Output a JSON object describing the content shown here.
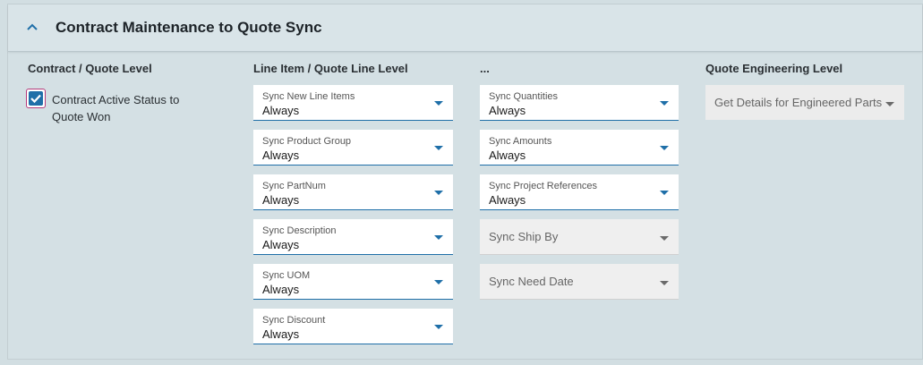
{
  "section": {
    "title": "Contract Maintenance to Quote Sync"
  },
  "columns": {
    "contract": "Contract / Quote Level",
    "line_item": "Line Item / Quote Line Level",
    "more": "...",
    "engineering": "Quote Engineering Level"
  },
  "contract_active": {
    "label": "Contract Active Status to Quote Won",
    "checked": true
  },
  "line_item_dropdowns": [
    {
      "label": "Sync New Line Items",
      "value": "Always"
    },
    {
      "label": "Sync Product Group",
      "value": "Always"
    },
    {
      "label": "Sync PartNum",
      "value": "Always"
    },
    {
      "label": "Sync Description",
      "value": "Always"
    },
    {
      "label": "Sync UOM",
      "value": "Always"
    },
    {
      "label": "Sync Discount",
      "value": "Always"
    }
  ],
  "more_dropdowns": [
    {
      "label": "Sync Quantities",
      "value": "Always"
    },
    {
      "label": "Sync Amounts",
      "value": "Always"
    },
    {
      "label": "Sync Project References",
      "value": "Always"
    }
  ],
  "disabled_dropdowns": [
    {
      "placeholder": "Sync Ship By"
    },
    {
      "placeholder": "Sync Need Date"
    }
  ],
  "engineering_dropdown": {
    "placeholder": "Get Details for Engineered Parts"
  },
  "colors": {
    "accent": "#1f6fa8",
    "background": "#d2dee2"
  }
}
